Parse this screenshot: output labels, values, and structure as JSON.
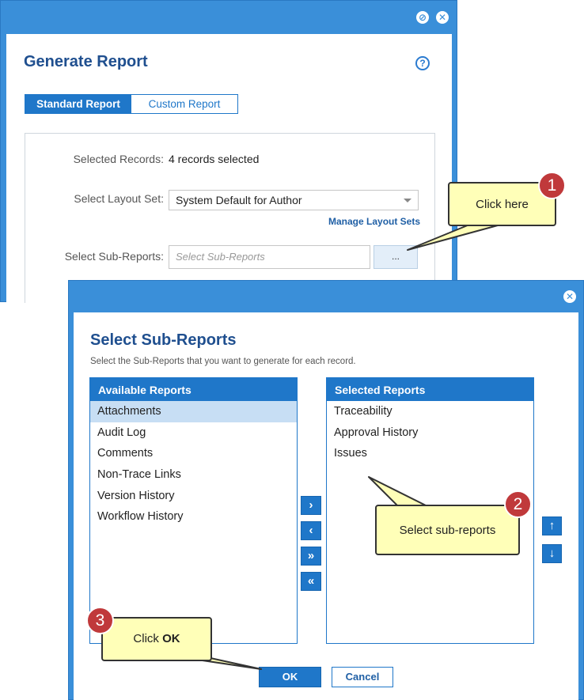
{
  "generate_report": {
    "title": "Generate Report",
    "tabs": [
      "Standard Report",
      "Custom Report"
    ],
    "selected_records_label": "Selected Records:",
    "selected_records_value": "4 records selected",
    "layout_set_label": "Select Layout Set:",
    "layout_set_value": "System Default for Author",
    "manage_layout_sets": "Manage Layout Sets",
    "sub_reports_label": "Select Sub-Reports:",
    "sub_reports_placeholder": "Select Sub-Reports",
    "browse_label": "..."
  },
  "select_sub_reports": {
    "title": "Select Sub-Reports",
    "description": "Select the Sub-Reports that you want to generate for each record.",
    "available_header": "Available Reports",
    "available_items": [
      "Attachments",
      "Audit Log",
      "Comments",
      "Non-Trace Links",
      "Version History",
      "Workflow History"
    ],
    "selected_header": "Selected Reports",
    "selected_items": [
      "Traceability",
      "Approval History",
      "Issues"
    ],
    "ok_label": "OK",
    "cancel_label": "Cancel"
  },
  "callouts": {
    "one": {
      "number": "1",
      "text": "Click here"
    },
    "two": {
      "number": "2",
      "text": "Select sub-reports"
    },
    "three": {
      "number": "3",
      "text_prefix": "Click ",
      "text_bold": "OK"
    }
  },
  "colors": {
    "accent": "#1f77c9",
    "dialog_frame": "#3a8fd9",
    "callout_fill": "#ffffb8",
    "badge": "#c0393b",
    "title": "#1f4f8f"
  }
}
